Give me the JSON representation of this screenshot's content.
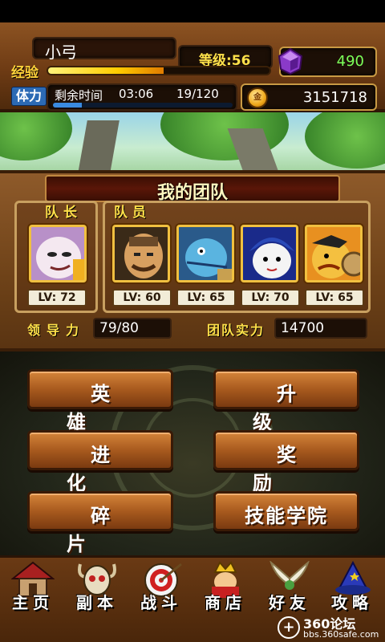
{
  "player": {
    "name": "小弓",
    "exp_label": "经验",
    "exp_progress": 0.52,
    "level_text": "等级:56",
    "stamina_label": "体力",
    "stamina_timer_label": "剩余时间",
    "stamina_timer": "03:06",
    "stamina_value": "19/120",
    "stamina_progress": 0.16,
    "gems": "490",
    "gold": "3151718",
    "gold_icon_text": "金"
  },
  "team": {
    "title": "我的团队",
    "leader_label": "队长",
    "members_label": "队员",
    "leader": {
      "lv": "LV: 72"
    },
    "members": [
      {
        "lv": "LV: 60"
      },
      {
        "lv": "LV: 65"
      },
      {
        "lv": "LV: 70"
      },
      {
        "lv": "LV: 65"
      }
    ],
    "leadership_label": "领导力",
    "leadership_value": "79/80",
    "power_label": "团队实力",
    "power_value": "14700"
  },
  "menu": {
    "heroes": "英雄",
    "upgrade": "升级",
    "evolve": "进化",
    "reward": "奖励",
    "fragments": "碎片",
    "skill_academy": "技能学院"
  },
  "nav": {
    "home": "主页",
    "dungeon": "副本",
    "battle": "战斗",
    "shop": "商店",
    "friends": "好友",
    "guide": "攻略"
  },
  "watermark": {
    "brand": "360论坛",
    "url": "bbs.360safe.com"
  },
  "colors": {
    "gold_text": "#ffe14a",
    "gem_text": "#7cff5a",
    "wood": "#7a4218"
  }
}
